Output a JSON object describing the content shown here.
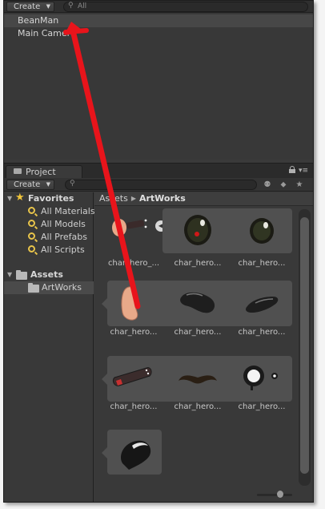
{
  "hierarchy": {
    "create_label": "Create",
    "search_placeholder": "All",
    "items": [
      {
        "label": "BeanMan",
        "selected": true
      },
      {
        "label": "Main Camera",
        "selected": false
      }
    ]
  },
  "project": {
    "tab_label": "Project",
    "create_label": "Create",
    "breadcrumb": [
      "Assets",
      "ArtWorks"
    ],
    "favorites": {
      "label": "Favorites",
      "items": [
        "All Materials",
        "All Models",
        "All Prefabs",
        "All Scripts"
      ]
    },
    "assets": {
      "label": "Assets",
      "children": [
        {
          "label": "ArtWorks",
          "selected": true
        }
      ]
    },
    "grid_items": [
      {
        "label": "char_hero_...",
        "icon": "sprite-sheet-thumbnail"
      },
      {
        "label": "char_hero...",
        "icon": "eye-red-pupil-sprite"
      },
      {
        "label": "char_hero...",
        "icon": "eye-sprite"
      },
      {
        "label": "char_hero...",
        "icon": "bean-body-sprite"
      },
      {
        "label": "char_hero...",
        "icon": "dark-bean-sprite"
      },
      {
        "label": "char_hero...",
        "icon": "dark-bean-small-sprite"
      },
      {
        "label": "char_hero...",
        "icon": "cannon-arm-sprite"
      },
      {
        "label": "char_hero...",
        "icon": "mustache-sprite"
      },
      {
        "label": "char_hero...",
        "icon": "monocle-sprite"
      },
      {
        "label": "",
        "icon": "cap-sprite"
      }
    ]
  },
  "annotation": {
    "color": "#e8141b"
  }
}
